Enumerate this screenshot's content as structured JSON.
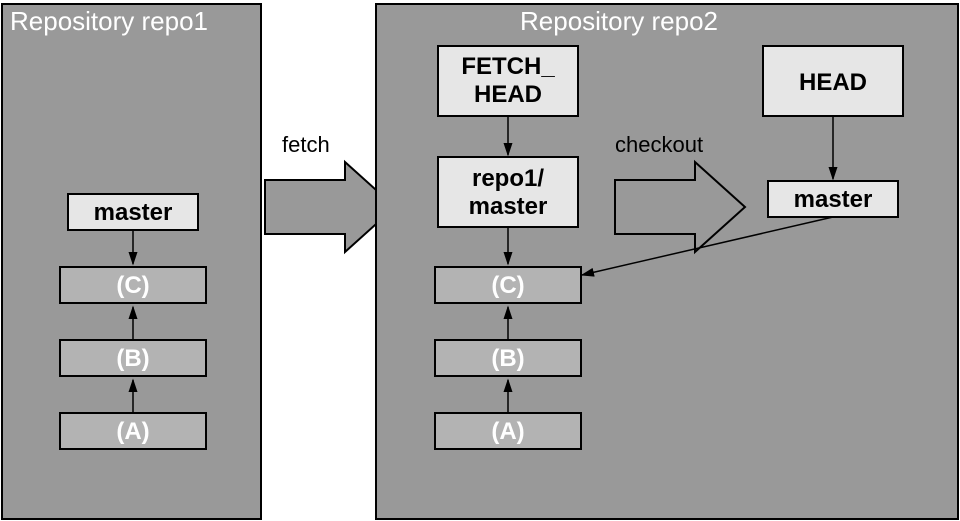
{
  "repo1": {
    "title": "Repository repo1",
    "ref_master": "master",
    "commit_c": "(C)",
    "commit_b": "(B)",
    "commit_a": "(A)"
  },
  "action": {
    "fetch": "fetch",
    "checkout": "checkout"
  },
  "repo2": {
    "title": "Repository repo2",
    "fetch_head_l1": "FETCH_",
    "fetch_head_l2": "HEAD",
    "remote_master_l1": "repo1/",
    "remote_master_l2": "master",
    "commit_c": "(C)",
    "commit_b": "(B)",
    "commit_a": "(A)",
    "head": "HEAD",
    "ref_master": "master"
  }
}
